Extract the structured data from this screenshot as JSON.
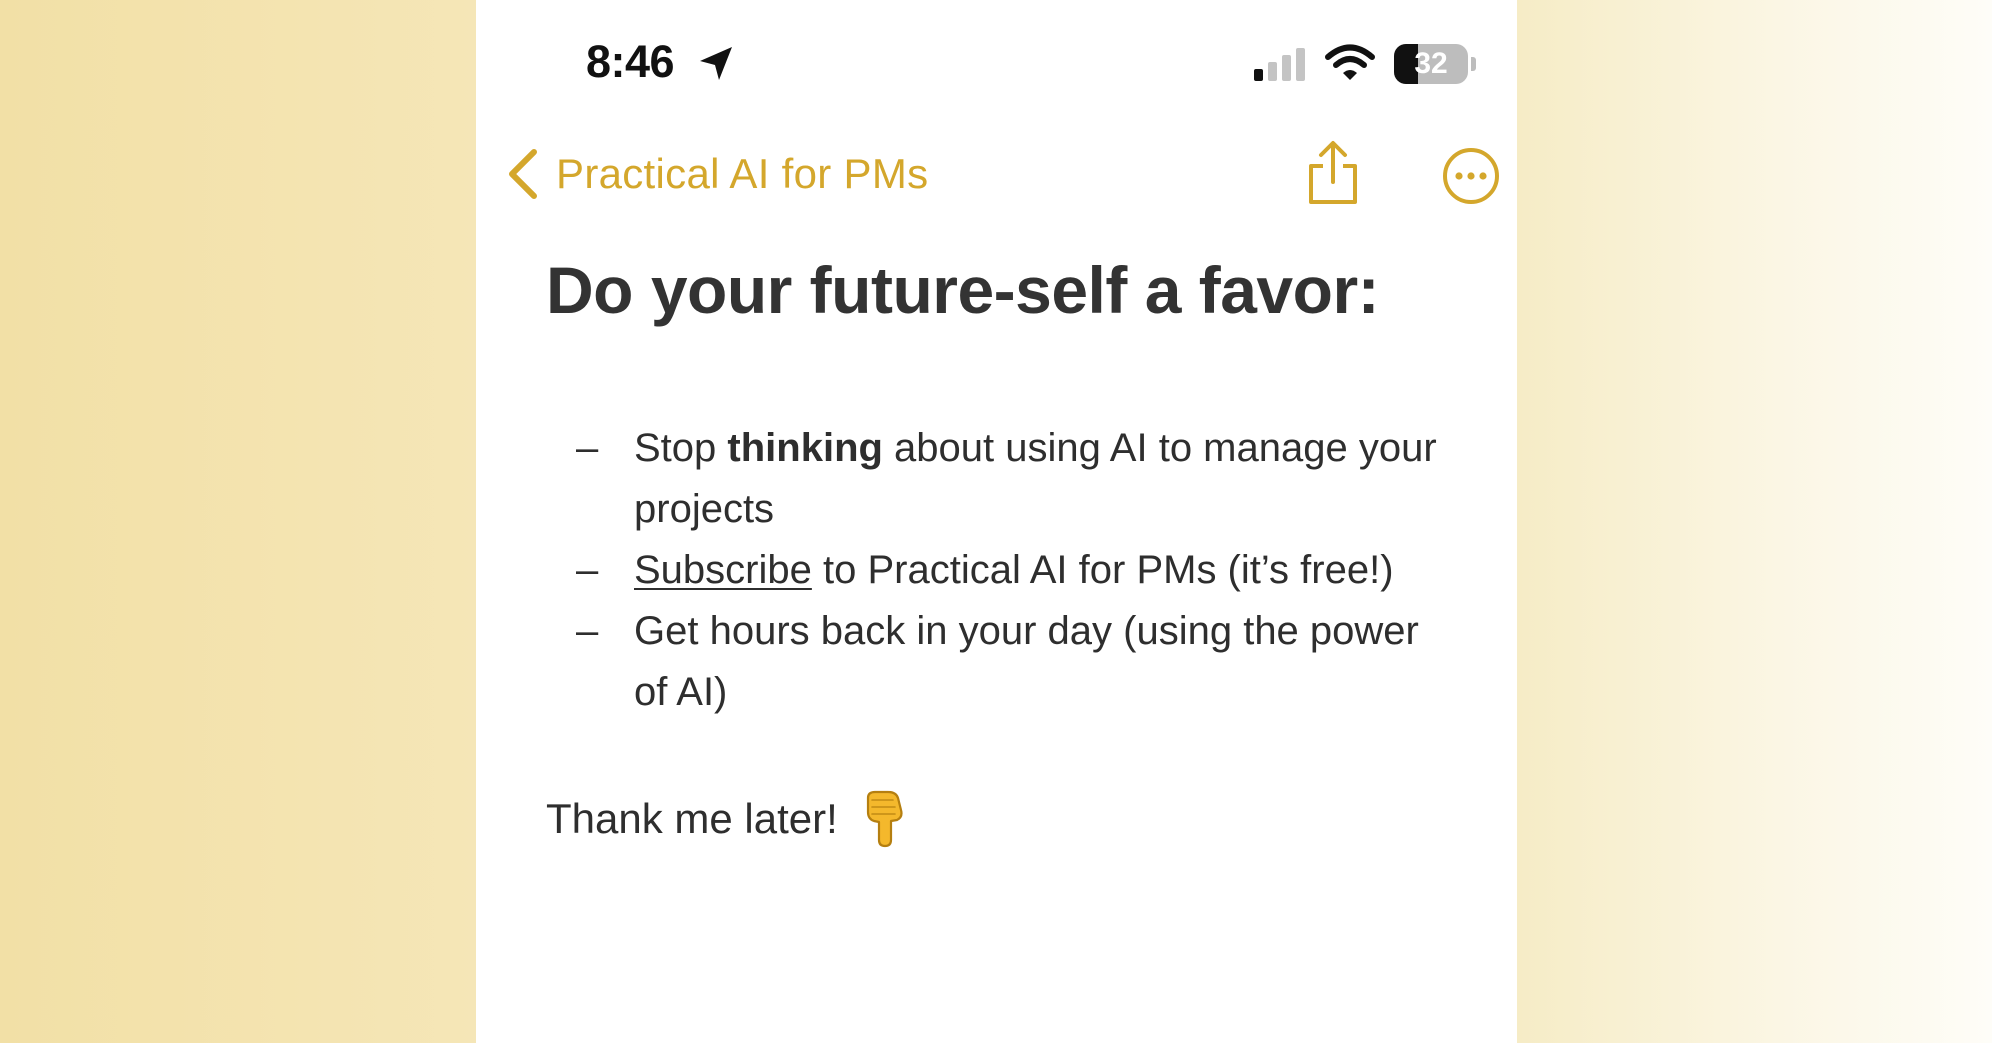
{
  "status_bar": {
    "time": "8:46",
    "battery": "32",
    "battery_level": 0.32,
    "icons": [
      "location-arrow-icon",
      "cellular-signal-icon",
      "wifi-icon",
      "battery-icon"
    ]
  },
  "nav": {
    "back_label": "Practical AI for PMs",
    "icons": [
      "chevron-left-icon",
      "share-icon",
      "more-icon"
    ]
  },
  "note": {
    "title": "Do your future-self a favor:",
    "bullet": "–",
    "items": [
      {
        "before": "Stop ",
        "bold": "thinking",
        "after": " about using AI to manage your projects"
      },
      {
        "link": "Subscribe",
        "after": " to Practical AI for PMs (it’s free!)"
      },
      {
        "text": "Get hours back in your day (using the power of AI)"
      }
    ],
    "closing": "Thank me later!",
    "closing_emoji": "pointing-down-hand-icon"
  },
  "colors": {
    "accent": "#d4a72c",
    "text": "#2e2e2e",
    "background_left": "#f2e0a6",
    "background_right": "#fbf6e4"
  }
}
